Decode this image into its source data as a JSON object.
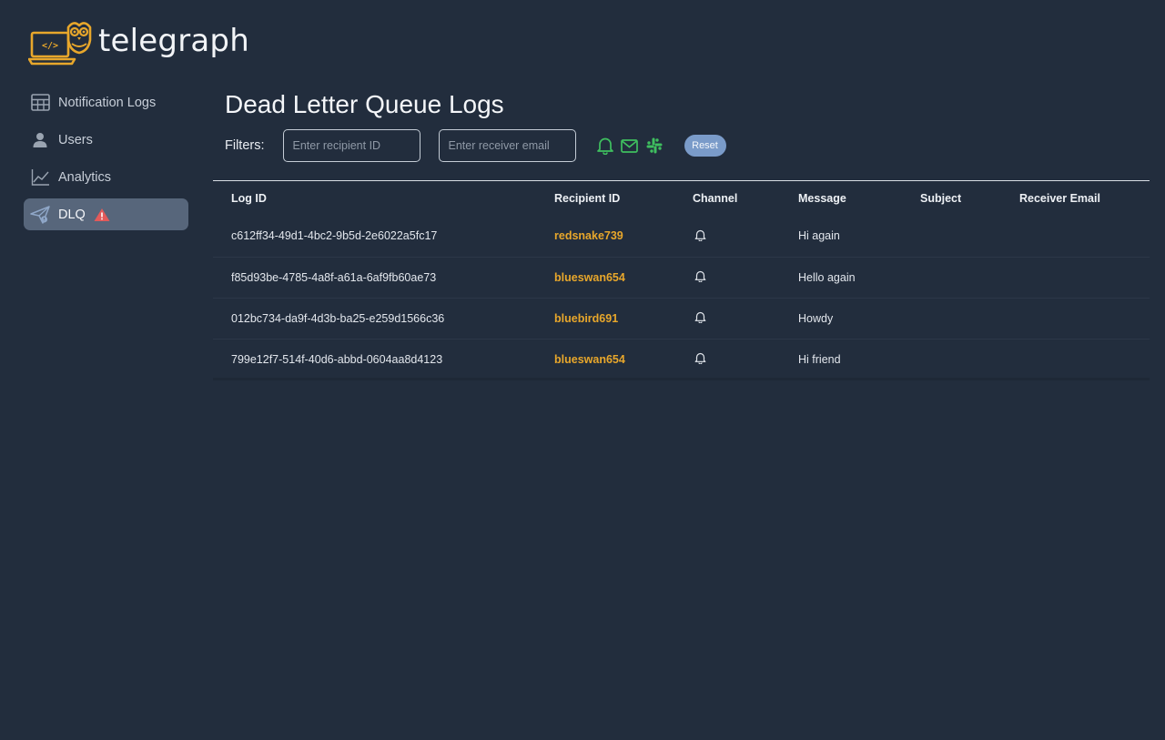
{
  "brand": {
    "name": "telegraph"
  },
  "sidebar": {
    "items": [
      {
        "label": "Notification Logs",
        "icon": "table-icon"
      },
      {
        "label": "Users",
        "icon": "user-icon"
      },
      {
        "label": "Analytics",
        "icon": "line-chart-icon"
      },
      {
        "label": "DLQ",
        "icon": "paper-plane-icon",
        "active": true,
        "badge": "warning-icon"
      }
    ]
  },
  "main": {
    "title": "Dead Letter Queue Logs",
    "filters": {
      "label": "Filters:",
      "recipient_placeholder": "Enter recipient ID",
      "email_placeholder": "Enter receiver email",
      "channels": [
        "bell-icon",
        "mail-icon",
        "slack-icon"
      ],
      "reset_label": "Reset"
    },
    "table": {
      "headers": [
        "Log ID",
        "Recipient ID",
        "Channel",
        "Message",
        "Subject",
        "Receiver Email"
      ],
      "rows": [
        {
          "log_id": "c612ff34-49d1-4bc2-9b5d-2e6022a5fc17",
          "recipient": "redsnake739",
          "channel": "bell-icon",
          "message": "Hi again",
          "subject": "",
          "email": ""
        },
        {
          "log_id": "f85d93be-4785-4a8f-a61a-6af9fb60ae73",
          "recipient": "blueswan654",
          "channel": "bell-icon",
          "message": "Hello again",
          "subject": "",
          "email": ""
        },
        {
          "log_id": "012bc734-da9f-4d3b-ba25-e259d1566c36",
          "recipient": "bluebird691",
          "channel": "bell-icon",
          "message": "Howdy",
          "subject": "",
          "email": ""
        },
        {
          "log_id": "799e12f7-514f-40d6-abbd-0604aa8d4123",
          "recipient": "blueswan654",
          "channel": "bell-icon",
          "message": "Hi friend",
          "subject": "",
          "email": ""
        }
      ]
    }
  },
  "colors": {
    "background": "#222d3d",
    "accent": "#e8a72b",
    "channel_green": "#3fbf5f",
    "reset_button": "#7a9bc9",
    "warning": "#e35a5a",
    "active_nav": "#57667b"
  }
}
